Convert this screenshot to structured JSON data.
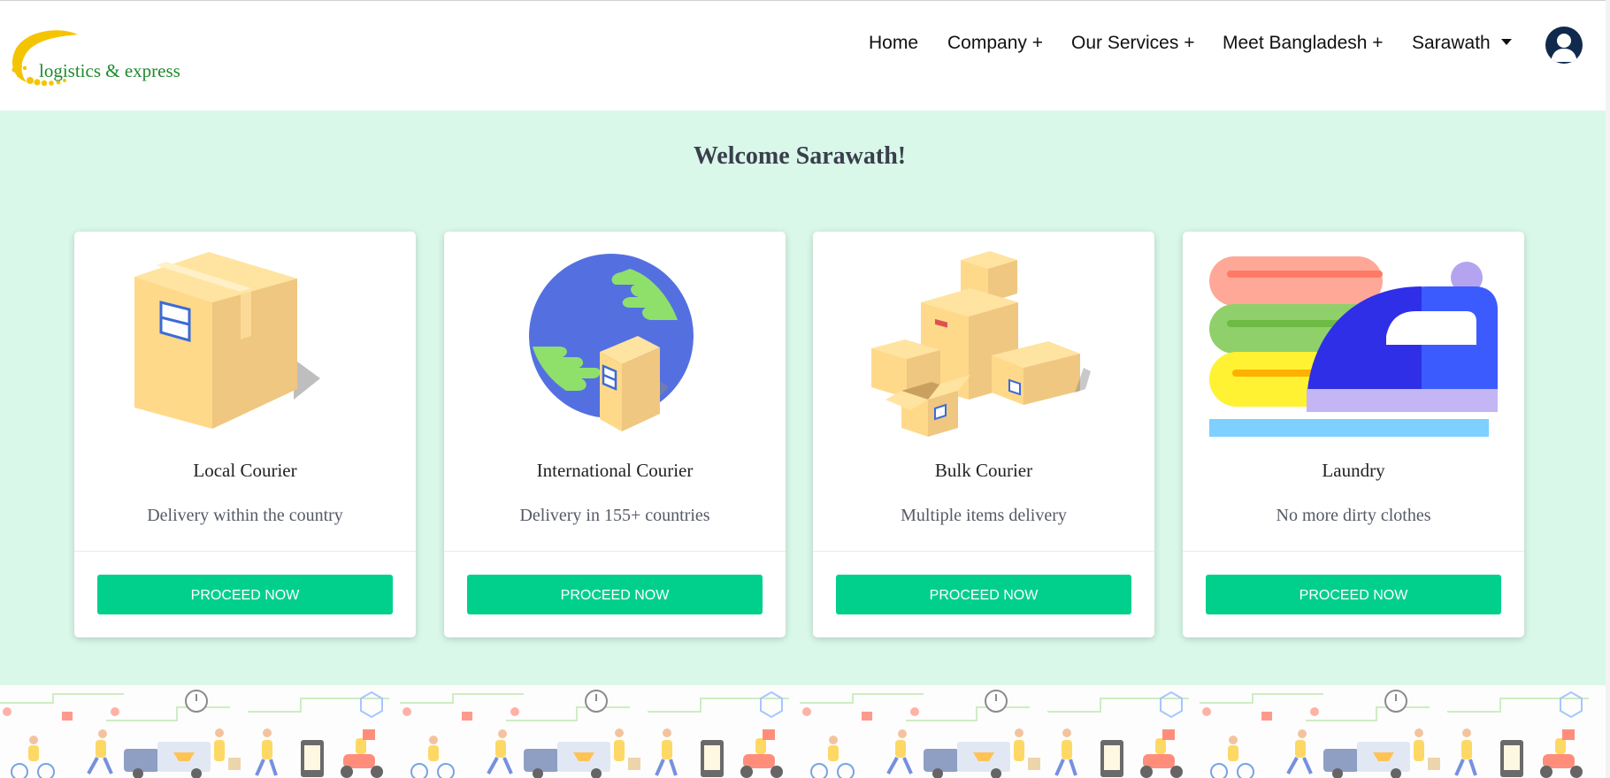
{
  "logo": {
    "text": "logistics & express",
    "icon": "crescent-logo"
  },
  "nav": {
    "items": [
      {
        "label": "Home"
      },
      {
        "label": "Company +"
      },
      {
        "label": "Our Services +"
      },
      {
        "label": "Meet Bangladesh +"
      }
    ],
    "user": {
      "name": "Sarawath",
      "icon": "user-avatar-icon"
    }
  },
  "welcome": "Welcome Sarawath!",
  "cards": [
    {
      "title": "Local Courier",
      "desc": "Delivery within the country",
      "button": "PROCEED NOW",
      "icon": "box-icon"
    },
    {
      "title": "International Courier",
      "desc": "Delivery in 155+ countries",
      "button": "PROCEED NOW",
      "icon": "globe-box-icon"
    },
    {
      "title": "Bulk Courier",
      "desc": "Multiple items delivery",
      "button": "PROCEED NOW",
      "icon": "boxes-icon"
    },
    {
      "title": "Laundry",
      "desc": "No more dirty clothes",
      "button": "PROCEED NOW",
      "icon": "iron-clothes-icon"
    }
  ],
  "colors": {
    "accent": "#00d08c",
    "main_bg": "#d9f8ea",
    "avatar": "#0f2a4d",
    "logo_yellow": "#f5c400",
    "logo_green": "#1e8a2c"
  }
}
